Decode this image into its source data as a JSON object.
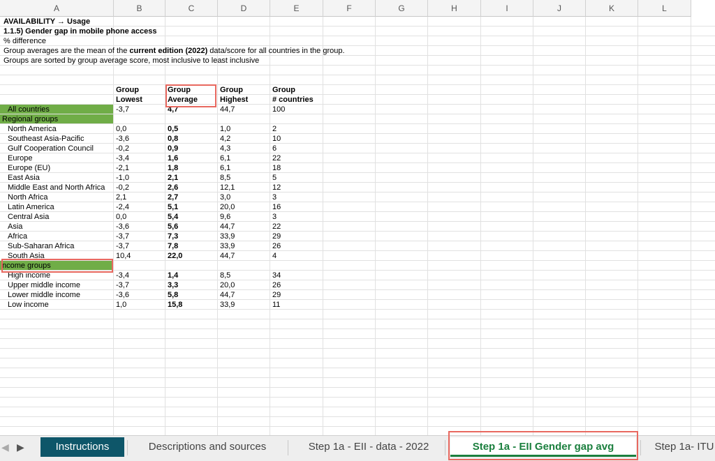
{
  "columns": [
    "A",
    "B",
    "C",
    "D",
    "E",
    "F",
    "G",
    "H",
    "I",
    "J",
    "K",
    "L"
  ],
  "header_lines": {
    "title": "AVAILABILITY → Usage",
    "indicator": "1.1.5) Gender gap in mobile phone access",
    "unit": "% difference",
    "note1_pre": "Group averages are the mean of the ",
    "note1_bold": "current edition (2022)",
    "note1_post": " data/score for all countries in the group.",
    "note2": "Groups are sorted by group average score, most inclusive to least inclusive"
  },
  "table_headers": {
    "lowest": [
      "Group",
      "Lowest"
    ],
    "average": [
      "Group",
      "Average"
    ],
    "highest": [
      "Group",
      "Highest"
    ],
    "count": [
      "Group",
      "# countries"
    ]
  },
  "rows": [
    {
      "label": "All countries",
      "low": "-3,7",
      "avg": "4,7",
      "high": "44,7",
      "n": "100",
      "style": "allc"
    },
    {
      "label": "Regional groups",
      "low": "",
      "avg": "",
      "high": "",
      "n": "",
      "style": "section"
    },
    {
      "label": "North America",
      "low": "0,0",
      "avg": "0,5",
      "high": "1,0",
      "n": "2",
      "style": "item"
    },
    {
      "label": "Southeast Asia-Pacific",
      "low": "-3,6",
      "avg": "0,8",
      "high": "4,2",
      "n": "10",
      "style": "item"
    },
    {
      "label": "Gulf Cooperation Council",
      "low": "-0,2",
      "avg": "0,9",
      "high": "4,3",
      "n": "6",
      "style": "item"
    },
    {
      "label": "Europe",
      "low": "-3,4",
      "avg": "1,6",
      "high": "6,1",
      "n": "22",
      "style": "item"
    },
    {
      "label": "Europe (EU)",
      "low": "-2,1",
      "avg": "1,8",
      "high": "6,1",
      "n": "18",
      "style": "item"
    },
    {
      "label": "East Asia",
      "low": "-1,0",
      "avg": "2,1",
      "high": "8,5",
      "n": "5",
      "style": "item"
    },
    {
      "label": "Middle East and North Africa",
      "low": "-0,2",
      "avg": "2,6",
      "high": "12,1",
      "n": "12",
      "style": "item"
    },
    {
      "label": "North Africa",
      "low": "2,1",
      "avg": "2,7",
      "high": "3,0",
      "n": "3",
      "style": "item"
    },
    {
      "label": "Latin America",
      "low": "-2,4",
      "avg": "5,1",
      "high": "20,0",
      "n": "16",
      "style": "item"
    },
    {
      "label": "Central Asia",
      "low": "0,0",
      "avg": "5,4",
      "high": "9,6",
      "n": "3",
      "style": "item"
    },
    {
      "label": "Asia",
      "low": "-3,6",
      "avg": "5,6",
      "high": "44,7",
      "n": "22",
      "style": "item"
    },
    {
      "label": "Africa",
      "low": "-3,7",
      "avg": "7,3",
      "high": "33,9",
      "n": "29",
      "style": "item"
    },
    {
      "label": "Sub-Saharan Africa",
      "low": "-3,7",
      "avg": "7,8",
      "high": "33,9",
      "n": "26",
      "style": "item"
    },
    {
      "label": "South Asia",
      "low": "10,4",
      "avg": "22,0",
      "high": "44,7",
      "n": "4",
      "style": "item"
    },
    {
      "label": "ncome groups",
      "low": "",
      "avg": "",
      "high": "",
      "n": "",
      "style": "section"
    },
    {
      "label": "High income",
      "low": "-3,4",
      "avg": "1,4",
      "high": "8,5",
      "n": "34",
      "style": "item"
    },
    {
      "label": "Upper middle income",
      "low": "-3,7",
      "avg": "3,3",
      "high": "20,0",
      "n": "26",
      "style": "item"
    },
    {
      "label": "Lower middle income",
      "low": "-3,6",
      "avg": "5,8",
      "high": "44,7",
      "n": "29",
      "style": "item"
    },
    {
      "label": "Low income",
      "low": "1,0",
      "avg": "15,8",
      "high": "33,9",
      "n": "11",
      "style": "item"
    }
  ],
  "tabs": [
    {
      "label": "Instructions",
      "state": "blue"
    },
    {
      "label": "Descriptions and sources",
      "state": "normal"
    },
    {
      "label": "Step 1a - EII - data - 2022",
      "state": "normal"
    },
    {
      "label": "Step 1a - EII Gender gap avg",
      "state": "active"
    },
    {
      "label": "Step 1a- ITU",
      "state": "normal"
    }
  ],
  "colors": {
    "section_fill": "#70ad47",
    "highlight_box": "#e8685f",
    "active_tab_text": "#1b7f3e",
    "instructions_tab": "#0e5669"
  }
}
